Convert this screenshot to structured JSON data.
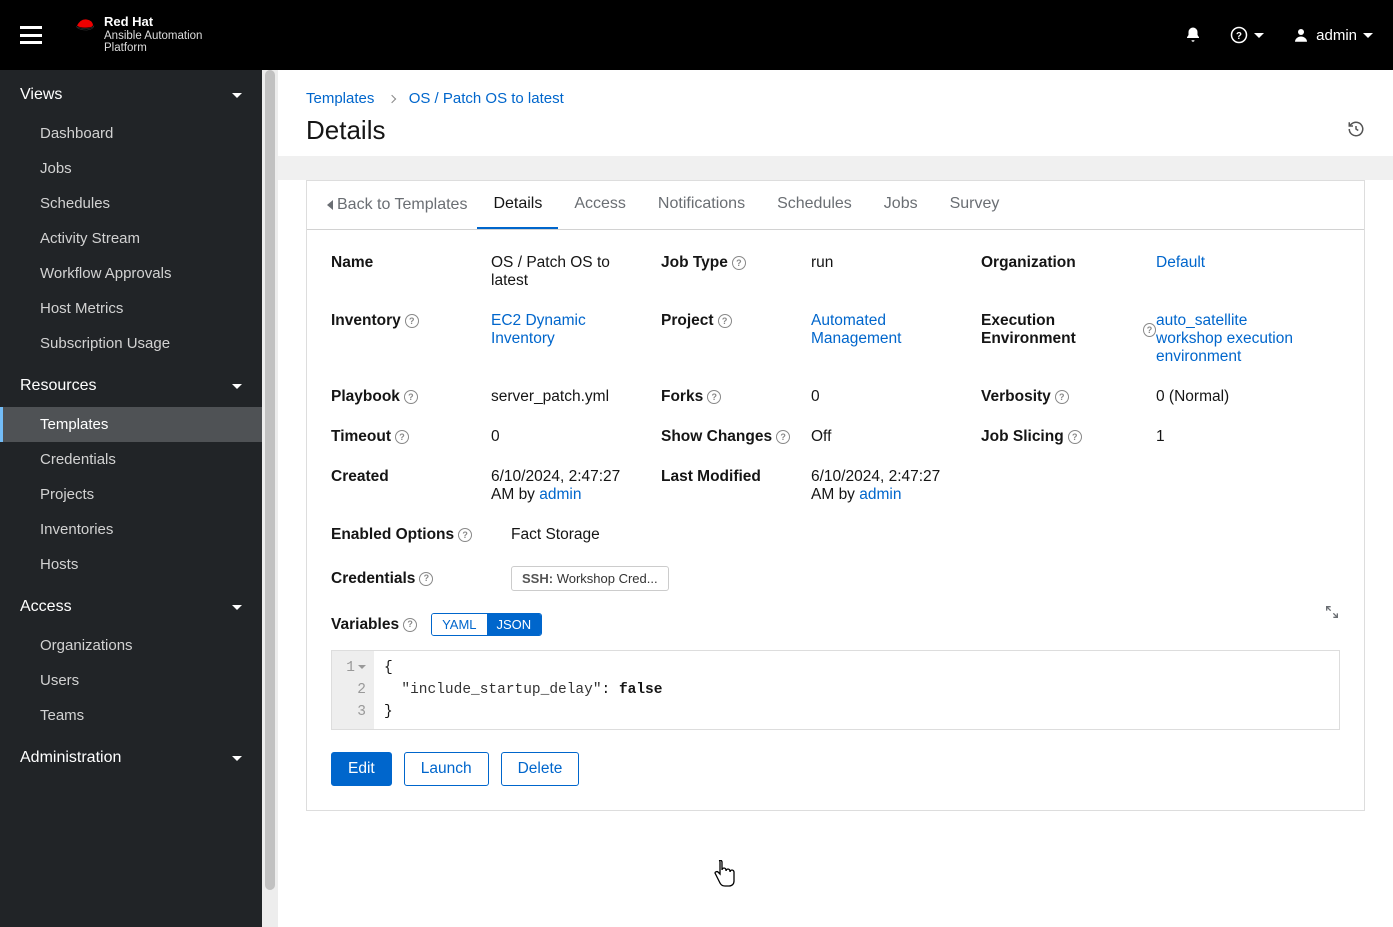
{
  "brand": {
    "name": "Red Hat",
    "product": "Ansible Automation",
    "platform": "Platform"
  },
  "user": {
    "name": "admin"
  },
  "sidebar": {
    "views": {
      "title": "Views",
      "items": [
        "Dashboard",
        "Jobs",
        "Schedules",
        "Activity Stream",
        "Workflow Approvals",
        "Host Metrics",
        "Subscription Usage"
      ]
    },
    "resources": {
      "title": "Resources",
      "items": [
        "Templates",
        "Credentials",
        "Projects",
        "Inventories",
        "Hosts"
      ],
      "active": 0
    },
    "access": {
      "title": "Access",
      "items": [
        "Organizations",
        "Users",
        "Teams"
      ]
    },
    "administration": {
      "title": "Administration"
    }
  },
  "breadcrumb": {
    "templates": "Templates",
    "current": "OS / Patch OS to latest"
  },
  "page_title": "Details",
  "tabs": {
    "back": "Back to Templates",
    "items": [
      "Details",
      "Access",
      "Notifications",
      "Schedules",
      "Jobs",
      "Survey"
    ],
    "active": 0
  },
  "fields": {
    "name": {
      "label": "Name",
      "value": "OS / Patch OS to latest"
    },
    "job_type": {
      "label": "Job Type",
      "value": "run"
    },
    "organization": {
      "label": "Organization",
      "value": "Default",
      "link": true
    },
    "inventory": {
      "label": "Inventory",
      "value": "EC2 Dynamic Inventory",
      "link": true
    },
    "project": {
      "label": "Project",
      "value": "Automated Management",
      "link": true
    },
    "exec_env": {
      "label": "Execution Environment",
      "value": "auto_satellite workshop execution environment",
      "link": true
    },
    "playbook": {
      "label": "Playbook",
      "value": "server_patch.yml"
    },
    "forks": {
      "label": "Forks",
      "value": "0"
    },
    "verbosity": {
      "label": "Verbosity",
      "value": "0 (Normal)"
    },
    "timeout": {
      "label": "Timeout",
      "value": "0"
    },
    "show_changes": {
      "label": "Show Changes",
      "value": "Off"
    },
    "job_slicing": {
      "label": "Job Slicing",
      "value": "1"
    },
    "created": {
      "label": "Created",
      "value": "6/10/2024, 2:47:27 AM",
      "by": "by",
      "user": "admin"
    },
    "last_modified": {
      "label": "Last Modified",
      "value": "6/10/2024, 2:47:27 AM",
      "by": "by",
      "user": "admin"
    },
    "enabled_options": {
      "label": "Enabled Options",
      "value": "Fact Storage"
    },
    "credentials": {
      "label": "Credentials",
      "type": "SSH:",
      "value": "Workshop Cred..."
    },
    "variables": {
      "label": "Variables",
      "yaml": "YAML",
      "json": "JSON"
    }
  },
  "editor": {
    "lines": [
      "{",
      "  \"include_startup_delay\": false",
      "}"
    ],
    "line_nums": [
      "1",
      "2",
      "3"
    ]
  },
  "actions": {
    "edit": "Edit",
    "launch": "Launch",
    "delete": "Delete"
  }
}
